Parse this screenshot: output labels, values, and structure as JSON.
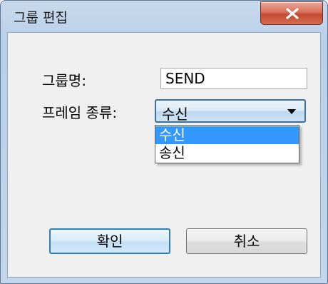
{
  "window": {
    "title": "그룹 편집",
    "close_icon": "close-icon"
  },
  "form": {
    "group_name_label": "그룹명:",
    "group_name_value": "SEND",
    "frame_type_label": "프레임 종류:",
    "frame_type_selected": "수신",
    "frame_type_options": [
      "수신",
      "송신"
    ]
  },
  "buttons": {
    "ok_label": "확인",
    "cancel_label": "취소"
  },
  "colors": {
    "selection": "#3399ff",
    "close_button": "#c9533b"
  }
}
